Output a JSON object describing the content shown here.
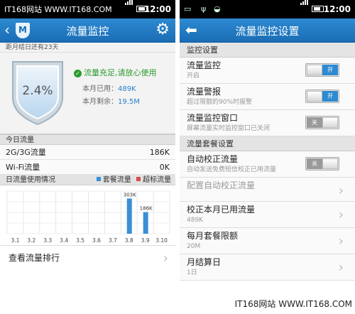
{
  "left": {
    "status": {
      "watermark": "IT168网站 WWW.IT168.COM",
      "time": "12:00"
    },
    "title": "流量监控",
    "logo_letter": "M",
    "subtitle": "距月结日还有23天",
    "hero": {
      "percent": "2.4%",
      "percent_value": 2.4,
      "status_text": "流量充足,请放心使用",
      "used_label": "本月已用：",
      "used_value": "489K",
      "remain_label": "本月剩余：",
      "remain_value": "19.5M"
    },
    "today": {
      "header": "今日流量",
      "rows": [
        {
          "label": "2G/3G流量",
          "value": "186K"
        },
        {
          "label": "Wi-Fi流量",
          "value": "0K"
        }
      ]
    },
    "chart_header": "日流量使用情况",
    "legend": [
      {
        "label": "套餐流量",
        "color": "#3a8fd6"
      },
      {
        "label": "超标流量",
        "color": "#d84a4a"
      }
    ],
    "rank_label": "查看流量排行"
  },
  "chart_data": {
    "type": "bar",
    "title": "日流量使用情况",
    "categories": [
      "3.1",
      "3.2",
      "3.3",
      "3.4",
      "3.5",
      "3.6",
      "3.7",
      "3.8",
      "3.9",
      "3.10"
    ],
    "series": [
      {
        "name": "套餐流量",
        "values": [
          0,
          0,
          0,
          0,
          0,
          0,
          0,
          303,
          186,
          0
        ],
        "color": "#3a8fd6"
      },
      {
        "name": "超标流量",
        "values": [
          0,
          0,
          0,
          0,
          0,
          0,
          0,
          0,
          0,
          0
        ],
        "color": "#d84a4a"
      }
    ],
    "data_labels": [
      "",
      "",
      "",
      "",
      "",
      "",
      "",
      "303K",
      "186K",
      ""
    ],
    "ylim": [
      0,
      330
    ],
    "grid": true
  },
  "right": {
    "status": {
      "time": "12:00"
    },
    "title": "流量监控设置",
    "sections": {
      "monitor": "监控设置",
      "plan": "流量套餐设置"
    },
    "monitor_items": [
      {
        "title": "流量监控",
        "subtitle": "开启",
        "toggle": "开",
        "on": true
      },
      {
        "title": "流量警报",
        "subtitle": "超过限额的90%时报警",
        "toggle": "开",
        "on": true
      },
      {
        "title": "流量监控窗口",
        "subtitle": "屏幕流量实时监控窗口已关闭",
        "toggle": "关",
        "on": false
      }
    ],
    "plan_items": [
      {
        "title": "自动校正流量",
        "subtitle": "自动发送免费短信校正已用流量",
        "toggle": "关",
        "on": false
      },
      {
        "title": "配置自动校正流量",
        "subtitle": ""
      },
      {
        "title": "校正本月已用流量",
        "subtitle": "489K"
      },
      {
        "title": "每月套餐限额",
        "subtitle": "20M"
      },
      {
        "title": "月结算日",
        "subtitle": "1日"
      }
    ],
    "watermark": "IT168网站 WWW.IT168.COM"
  }
}
